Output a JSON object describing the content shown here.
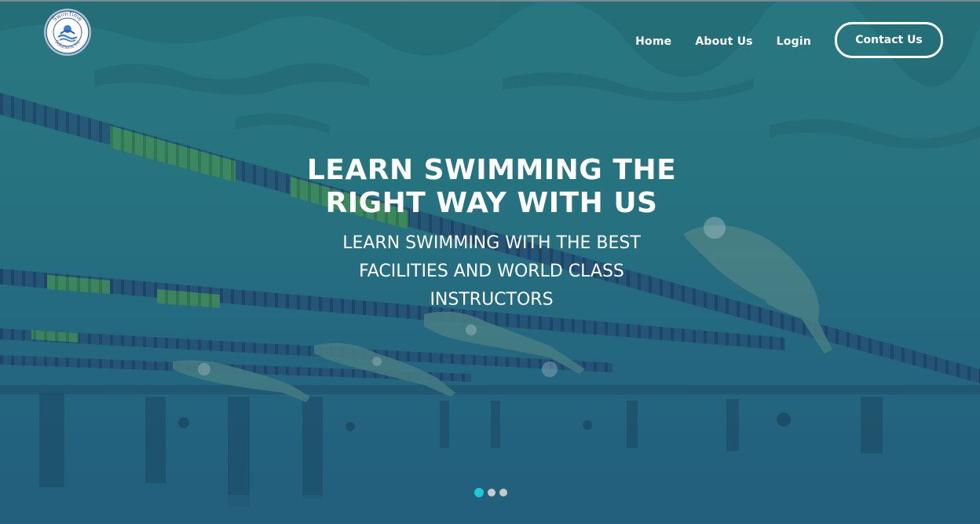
{
  "brand": {
    "logo_top_text": "SwimTime",
    "logo_bottom_text": "Solutions Inc"
  },
  "nav": {
    "items": [
      {
        "label": "Home"
      },
      {
        "label": "About Us"
      },
      {
        "label": "Login"
      }
    ],
    "contact_label": "Contact Us"
  },
  "hero": {
    "headline_line1": "LEARN SWIMMING THE",
    "headline_line2": "RIGHT WAY WITH US",
    "subhead_line1": "LEARN SWIMMING WITH THE BEST",
    "subhead_line2": "FACILITIES AND WORLD CLASS",
    "subhead_line3": "INSTRUCTORS"
  },
  "carousel": {
    "slide_count": 3,
    "active_index": 0
  },
  "colors": {
    "overlay": "#2f7580",
    "active_dot": "#1ccad6",
    "inactive_dot": "#c8c8c8",
    "text": "#ffffff"
  }
}
